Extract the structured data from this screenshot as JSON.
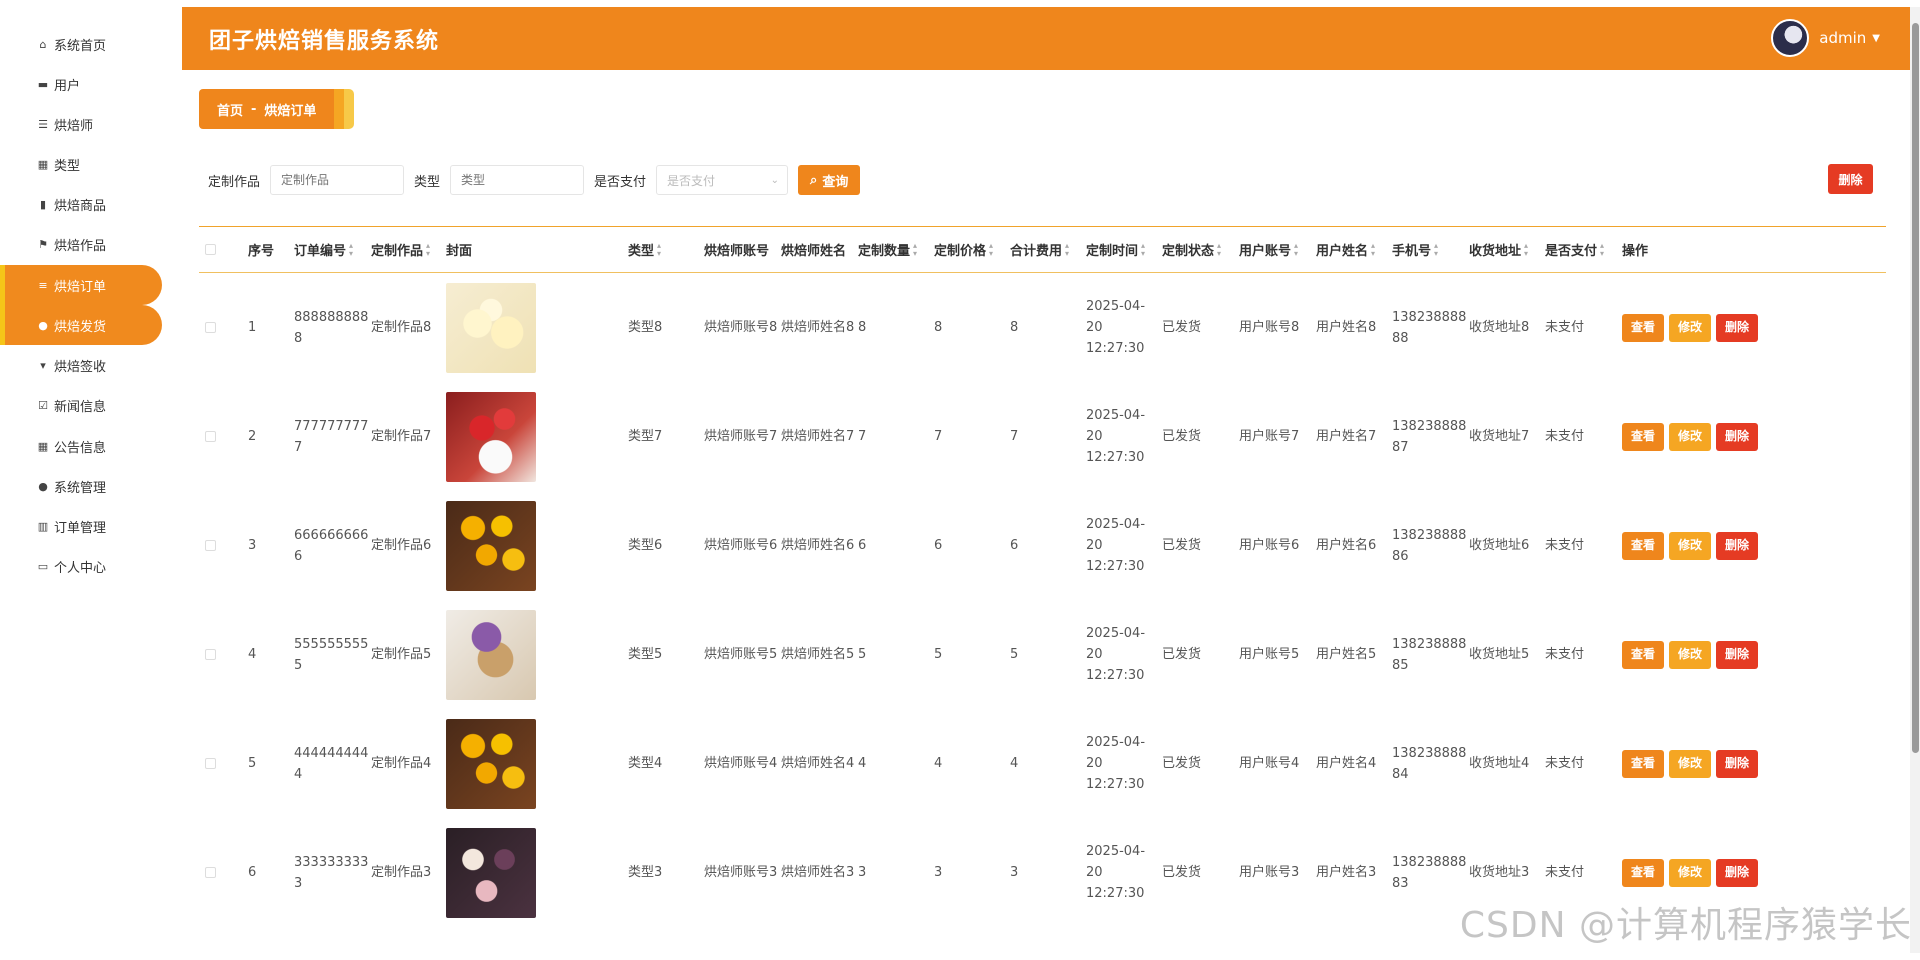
{
  "app": {
    "title": "团子烘焙销售服务系统",
    "user": "admin"
  },
  "sidebar": {
    "items": [
      {
        "label": "系统首页",
        "icon": "home-icon"
      },
      {
        "label": "用户",
        "icon": "monitor-icon"
      },
      {
        "label": "烘焙师",
        "icon": "list-icon"
      },
      {
        "label": "类型",
        "icon": "grid-icon"
      },
      {
        "label": "烘焙商品",
        "icon": "clipboard-icon"
      },
      {
        "label": "烘焙作品",
        "icon": "flag-icon"
      },
      {
        "label": "烘焙订单",
        "icon": "sliders-icon",
        "active": true
      },
      {
        "label": "烘焙发货",
        "icon": "user-icon",
        "active": true
      },
      {
        "label": "烘焙签收",
        "icon": "stamp-icon"
      },
      {
        "label": "新闻信息",
        "icon": "clipboard-check-icon"
      },
      {
        "label": "公告信息",
        "icon": "grid-icon"
      },
      {
        "label": "系统管理",
        "icon": "user-icon"
      },
      {
        "label": "订单管理",
        "icon": "bar-chart-icon"
      },
      {
        "label": "个人中心",
        "icon": "card-icon"
      }
    ]
  },
  "breadcrumb": {
    "home": "首页",
    "sep": "-",
    "current": "烘焙订单"
  },
  "search": {
    "work_label": "定制作品",
    "work_placeholder": "定制作品",
    "type_label": "类型",
    "type_placeholder": "类型",
    "paid_label": "是否支付",
    "paid_placeholder": "是否支付",
    "search_button": "查询",
    "delete_button": "删除"
  },
  "table": {
    "headers": [
      "序号",
      "订单编号",
      "定制作品",
      "封面",
      "类型",
      "烘焙师账号",
      "烘焙师姓名",
      "定制数量",
      "定制价格",
      "合计费用",
      "定制时间",
      "定制状态",
      "用户账号",
      "用户姓名",
      "手机号",
      "收货地址",
      "是否支付",
      "操作"
    ],
    "op_labels": {
      "view": "查看",
      "edit": "修改",
      "delete": "删除"
    },
    "rows": [
      {
        "idx": "1",
        "order_no": "888888888 8",
        "work": "定制作品8",
        "img": "cake-yellow",
        "type": "类型8",
        "baker_acc": "烘焙师账号8",
        "baker_name": "烘焙师姓名8",
        "qty": "8",
        "price": "8",
        "total": "8",
        "time": "2025-04-20 12:27:30",
        "status": "已发货",
        "user_acc": "用户账号8",
        "user_name": "用户姓名8",
        "phone": "138238888 88",
        "address": "收货地址8",
        "paid": "未支付"
      },
      {
        "idx": "2",
        "order_no": "777777777 7",
        "work": "定制作品7",
        "img": "cake-strawberry",
        "type": "类型7",
        "baker_acc": "烘焙师账号7",
        "baker_name": "烘焙师姓名7",
        "qty": "7",
        "price": "7",
        "total": "7",
        "time": "2025-04-20 12:27:30",
        "status": "已发货",
        "user_acc": "用户账号7",
        "user_name": "用户姓名7",
        "phone": "138238888 87",
        "address": "收货地址7",
        "paid": "未支付"
      },
      {
        "idx": "3",
        "order_no": "666666666 6",
        "work": "定制作品6",
        "img": "cake-tarts",
        "type": "类型6",
        "baker_acc": "烘焙师账号6",
        "baker_name": "烘焙师姓名6",
        "qty": "6",
        "price": "6",
        "total": "6",
        "time": "2025-04-20 12:27:30",
        "status": "已发货",
        "user_acc": "用户账号6",
        "user_name": "用户姓名6",
        "phone": "138238888 86",
        "address": "收货地址6",
        "paid": "未支付"
      },
      {
        "idx": "4",
        "order_no": "555555555 5",
        "work": "定制作品5",
        "img": "cake-purple",
        "type": "类型5",
        "baker_acc": "烘焙师账号5",
        "baker_name": "烘焙师姓名5",
        "qty": "5",
        "price": "5",
        "total": "5",
        "time": "2025-04-20 12:27:30",
        "status": "已发货",
        "user_acc": "用户账号5",
        "user_name": "用户姓名5",
        "phone": "138238888 85",
        "address": "收货地址5",
        "paid": "未支付"
      },
      {
        "idx": "5",
        "order_no": "444444444 4",
        "work": "定制作品4",
        "img": "cake-tarts",
        "type": "类型4",
        "baker_acc": "烘焙师账号4",
        "baker_name": "烘焙师姓名4",
        "qty": "4",
        "price": "4",
        "total": "4",
        "time": "2025-04-20 12:27:30",
        "status": "已发货",
        "user_acc": "用户账号4",
        "user_name": "用户姓名4",
        "phone": "138238888 84",
        "address": "收货地址4",
        "paid": "未支付"
      },
      {
        "idx": "6",
        "order_no": "333333333 3",
        "work": "定制作品3",
        "img": "cake-cupcakes",
        "type": "类型3",
        "baker_acc": "烘焙师账号3",
        "baker_name": "烘焙师姓名3",
        "qty": "3",
        "price": "3",
        "total": "3",
        "time": "2025-04-20 12:27:30",
        "status": "已发货",
        "user_acc": "用户账号3",
        "user_name": "用户姓名3",
        "phone": "138238888 83",
        "address": "收货地址3",
        "paid": "未支付"
      }
    ]
  },
  "colors": {
    "accent": "#ef861c",
    "danger": "#e53b23",
    "warning": "#f5a623",
    "highlight": "#f5c518"
  },
  "watermark": "CSDN @计算机程序猿学长"
}
